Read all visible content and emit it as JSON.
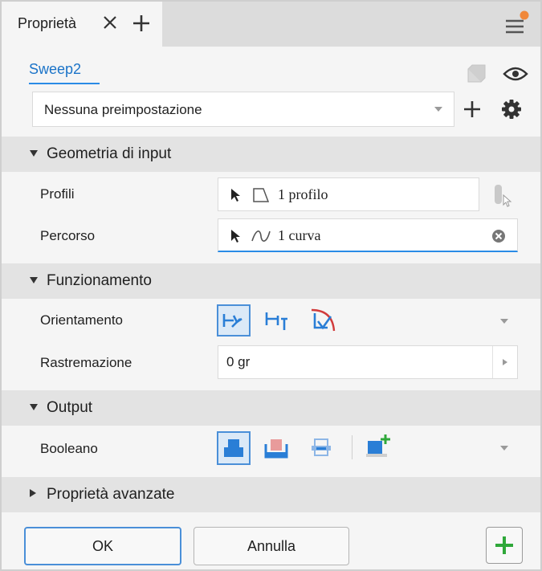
{
  "tab": {
    "title": "Proprietà",
    "close_icon": "close-icon",
    "add_icon": "plus-icon"
  },
  "menu": {
    "icon": "hamburger-menu-icon",
    "badge_color": "#f0883a"
  },
  "feature": {
    "name": "Sweep2"
  },
  "preset": {
    "value": "Nessuna preimpostazione"
  },
  "sections": {
    "input": {
      "label": "Geometria di input"
    },
    "behavior": {
      "label": "Funzionamento"
    },
    "output": {
      "label": "Output"
    },
    "advanced": {
      "label": "Proprietà avanzate"
    }
  },
  "input": {
    "profiles_label": "Profili",
    "profiles_value": "1 profilo",
    "path_label": "Percorso",
    "path_value": "1 curva"
  },
  "behavior": {
    "orientation_label": "Orientamento",
    "orientation_options": [
      "path-icon",
      "parallel-icon",
      "guide-rail-icon"
    ],
    "taper_label": "Rastremazione",
    "taper_value": "0 gr"
  },
  "output": {
    "boolean_label": "Booleano",
    "boolean_options": [
      "join-icon",
      "cut-icon",
      "intersect-icon",
      "new-solid-icon"
    ]
  },
  "footer": {
    "ok": "OK",
    "cancel": "Annulla"
  },
  "colors": {
    "accent": "#2a8be6",
    "selected_bg": "#dbe9f7",
    "header_bg": "#e3e3e3",
    "green": "#2fa83a"
  }
}
